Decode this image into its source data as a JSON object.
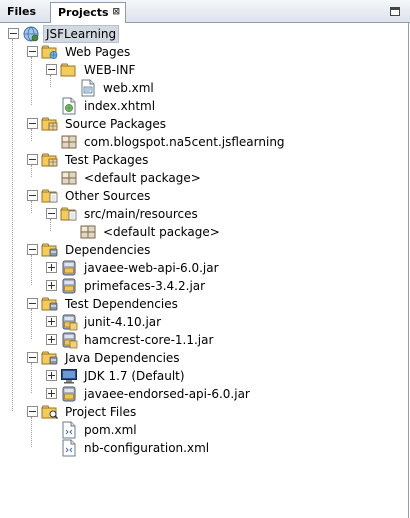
{
  "tabs": {
    "files_label": "Files",
    "projects_label": "Projects",
    "projects_close": "⊠"
  },
  "tree": [
    {
      "label": "JSFLearning",
      "icon": "globe-project-icon",
      "depth": 0,
      "toggle": "minus",
      "selected": true
    },
    {
      "label": "Web Pages",
      "icon": "web-folder-icon",
      "depth": 1,
      "toggle": "minus"
    },
    {
      "label": "WEB-INF",
      "icon": "folder-icon",
      "depth": 2,
      "toggle": "minus"
    },
    {
      "label": "web.xml",
      "icon": "xml-config-file-icon",
      "depth": 3,
      "toggle": "none"
    },
    {
      "label": "index.xhtml",
      "icon": "web-file-icon",
      "depth": 2,
      "toggle": "none"
    },
    {
      "label": "Source Packages",
      "icon": "package-folder-icon",
      "depth": 1,
      "toggle": "minus"
    },
    {
      "label": "com.blogspot.na5cent.jsflearning",
      "icon": "package-icon",
      "depth": 2,
      "toggle": "none"
    },
    {
      "label": "Test Packages",
      "icon": "package-folder-icon",
      "depth": 1,
      "toggle": "minus"
    },
    {
      "label": "<default package>",
      "icon": "package-icon",
      "depth": 2,
      "toggle": "none"
    },
    {
      "label": "Other Sources",
      "icon": "doc-folder-icon",
      "depth": 1,
      "toggle": "minus"
    },
    {
      "label": "src/main/resources",
      "icon": "doc-folder-icon",
      "depth": 2,
      "toggle": "minus"
    },
    {
      "label": "<default package>",
      "icon": "package-icon",
      "depth": 3,
      "toggle": "none"
    },
    {
      "label": "Dependencies",
      "icon": "jar-folder-icon",
      "depth": 1,
      "toggle": "minus"
    },
    {
      "label": "javaee-web-api-6.0.jar",
      "icon": "jar-icon",
      "depth": 2,
      "toggle": "plus"
    },
    {
      "label": "primefaces-3.4.2.jar",
      "icon": "jar-icon",
      "depth": 2,
      "toggle": "plus"
    },
    {
      "label": "Test Dependencies",
      "icon": "jar-folder-icon",
      "depth": 1,
      "toggle": "minus"
    },
    {
      "label": "junit-4.10.jar",
      "icon": "test-jar-icon",
      "depth": 2,
      "toggle": "plus"
    },
    {
      "label": "hamcrest-core-1.1.jar",
      "icon": "test-jar-icon",
      "depth": 2,
      "toggle": "plus"
    },
    {
      "label": "Java Dependencies",
      "icon": "jar-folder-icon",
      "depth": 1,
      "toggle": "minus"
    },
    {
      "label": "JDK 1.7 (Default)",
      "icon": "jdk-monitor-icon",
      "depth": 2,
      "toggle": "plus"
    },
    {
      "label": "javaee-endorsed-api-6.0.jar",
      "icon": "jar-icon",
      "depth": 2,
      "toggle": "plus"
    },
    {
      "label": "Project Files",
      "icon": "search-folder-icon",
      "depth": 1,
      "toggle": "minus"
    },
    {
      "label": "pom.xml",
      "icon": "xml-file-icon",
      "depth": 2,
      "toggle": "none"
    },
    {
      "label": "nb-configuration.xml",
      "icon": "xml-file-icon",
      "depth": 2,
      "toggle": "none"
    }
  ]
}
